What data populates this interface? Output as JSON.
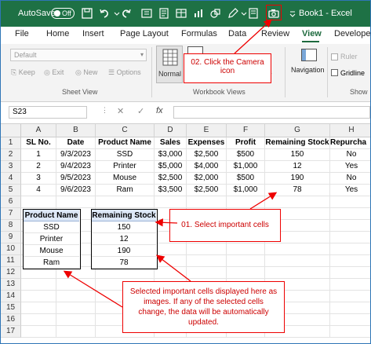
{
  "titlebar": {
    "autosave_label": "AutoSave",
    "toggle_state": "Off",
    "doc_title": "Book1 - Excel"
  },
  "tabs": [
    "File",
    "Home",
    "Insert",
    "Page Layout",
    "Formulas",
    "Data",
    "Review",
    "View",
    "Develope"
  ],
  "active_tab": "View",
  "ribbon": {
    "view_select": "Default",
    "sheet_view_buttons": [
      "Keep",
      "Exit",
      "New",
      "Options"
    ],
    "sheet_view_label": "Sheet View",
    "normal_label": "Normal",
    "workbook_views_label": "Workbook Views",
    "navigation_label": "Navigation",
    "ruler_label": "Ruler",
    "gridlines_label": "Gridline",
    "show_label": "Show"
  },
  "formula_bar": {
    "name_box": "S23",
    "cancel": "✕",
    "enter": "✓",
    "fx": "fx"
  },
  "columns": [
    "A",
    "B",
    "C",
    "D",
    "E",
    "F",
    "G",
    "H"
  ],
  "rows": [
    "1",
    "2",
    "3",
    "4",
    "5",
    "6",
    "7",
    "8",
    "9",
    "10",
    "11",
    "12",
    "13",
    "14",
    "15",
    "16",
    "17"
  ],
  "table": {
    "headers": [
      "SL No.",
      "Date",
      "Product Name",
      "Sales",
      "Expenses",
      "Profit",
      "Remaining Stock",
      "Repurcha"
    ],
    "rows": [
      [
        "1",
        "9/3/2023",
        "SSD",
        "$3,000",
        "$2,500",
        "$500",
        "150",
        "No"
      ],
      [
        "2",
        "9/4/2023",
        "Printer",
        "$5,000",
        "$4,000",
        "$1,000",
        "12",
        "Yes"
      ],
      [
        "3",
        "9/5/2023",
        "Mouse",
        "$2,500",
        "$2,000",
        "$500",
        "190",
        "No"
      ],
      [
        "4",
        "9/6/2023",
        "Ram",
        "$3,500",
        "$2,500",
        "$1,000",
        "78",
        "Yes"
      ]
    ]
  },
  "picture_product": {
    "header": "Product Name",
    "values": [
      "SSD",
      "Printer",
      "Mouse",
      "Ram"
    ]
  },
  "picture_stock": {
    "header": "Remaining Stock",
    "values": [
      "150",
      "12",
      "190",
      "78"
    ]
  },
  "callouts": {
    "camera": "02. Click the Camera icon",
    "select": "01. Select important cells",
    "explain": "Selected important cells displayed here as images. If any of the selected cells change, the data will be automatically updated."
  },
  "colors": {
    "excel_green": "#1e7145",
    "callout_red": "#e00000",
    "picture_header": "#dde8f7"
  }
}
